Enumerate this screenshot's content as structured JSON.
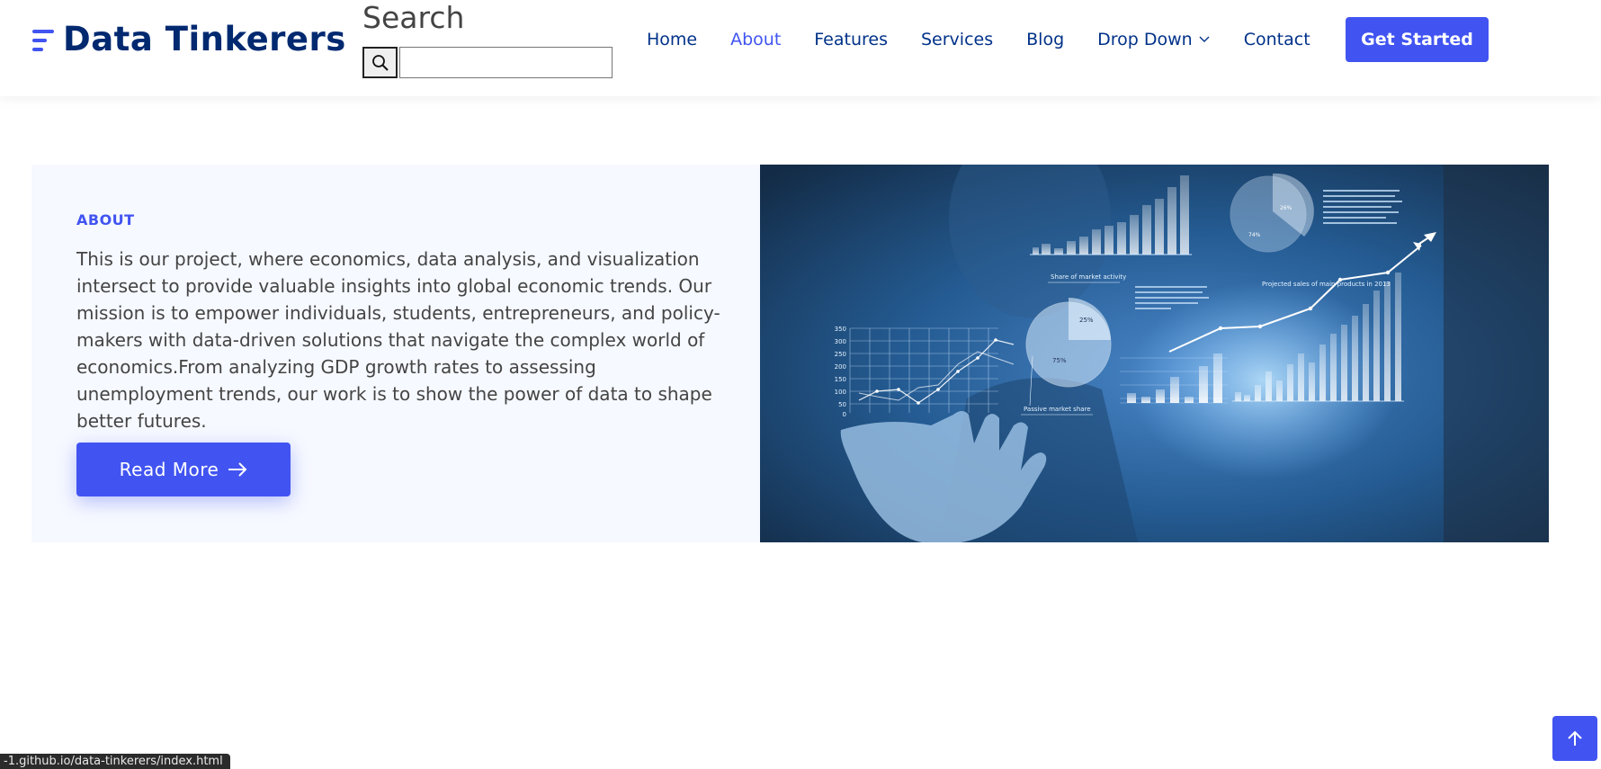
{
  "header": {
    "logo_text": "Data Tinkerers",
    "search": {
      "title": "Search",
      "input_value": "",
      "placeholder": ""
    },
    "nav": [
      {
        "label": "Home",
        "active": false
      },
      {
        "label": "About",
        "active": true
      },
      {
        "label": "Features",
        "active": false
      },
      {
        "label": "Services",
        "active": false
      },
      {
        "label": "Blog",
        "active": false
      },
      {
        "label": "Drop Down",
        "active": false,
        "has_dropdown": true
      },
      {
        "label": "Contact",
        "active": false
      }
    ],
    "cta_label": "Get Started"
  },
  "about": {
    "heading": "ABOUT",
    "body": "This is our project, where economics, data analysis, and visualization intersect to provide valuable insights into global economic trends. Our mission is to empower individuals, students, entrepreneurs, and policy-makers with data-driven solutions that navigate the complex world of economics.From analyzing GDP growth rates to assessing unemployment trends, our work is to show the power of data to shape better futures.",
    "button_label": "Read More",
    "image": {
      "chart_labels": {
        "share_of_market": "Share of market activity",
        "passive_market": "Passive market share",
        "projected_sales": "Projected sales of main products in 2013",
        "pie_small_a": "25%",
        "pie_small_b": "75%"
      }
    }
  },
  "status_bar": {
    "url": "-1.github.io/data-tinkerers/index.html"
  },
  "colors": {
    "accent": "#4154f1",
    "nav_text": "#012970",
    "body_text": "#444444",
    "section_bg": "#f6f9ff"
  },
  "icons": {
    "search": "search-icon",
    "chevron": "chevron-down-icon",
    "arrow": "arrow-right-icon",
    "back_to_top": "arrow-up-icon"
  }
}
